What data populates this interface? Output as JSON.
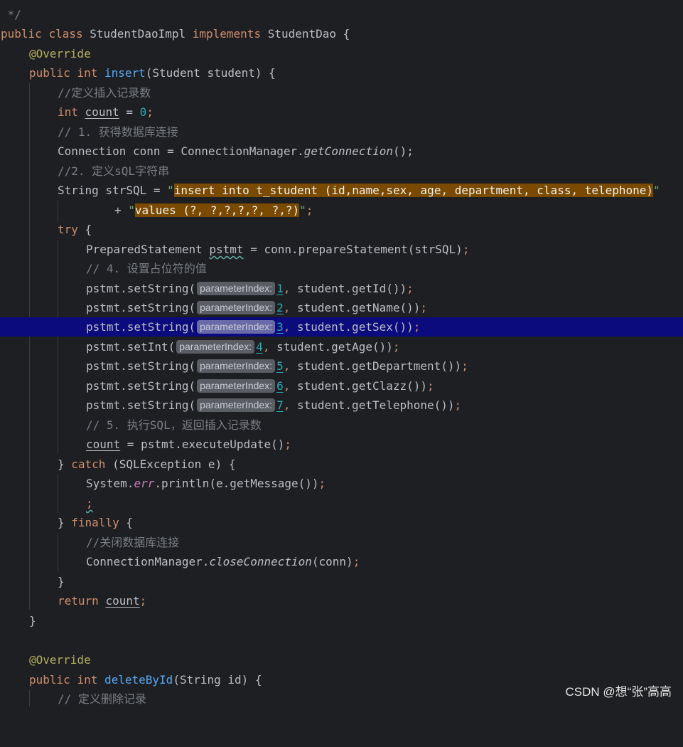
{
  "lines": {
    "l0": {
      "comment_close": " */"
    },
    "l1": {
      "kw_public": "public",
      "kw_class": "class",
      "class_name": "StudentDaoImpl",
      "kw_implements": "implements",
      "iface": "StudentDao {"
    },
    "l2": {
      "annotation": "@Override"
    },
    "l3": {
      "kw_public": "public",
      "kw_int": "int",
      "method": "insert",
      "params": "(Student student) {"
    },
    "l4": {
      "comment": "//定义插入记录数"
    },
    "l5": {
      "kw_int": "int",
      "var": "count",
      "eq": " = ",
      "num": "0",
      "semi": ";"
    },
    "l6": {
      "comment": "// 1. 获得数据库连接"
    },
    "l7": {
      "prefix": "Connection conn = ConnectionManager.",
      "call": "getConnection",
      "suffix": "();"
    },
    "l8": {
      "comment": "//2. 定义sQL字符串"
    },
    "l9": {
      "prefix": "String strSQL = ",
      "quote_open": "\"",
      "string": "insert into t_student (id,name,sex, age, department, class, telephone)",
      "quote_close": "\""
    },
    "l10": {
      "plus": "+ ",
      "quote_open": "\"",
      "string": "values (?, ?,?,?,?, ?,?)",
      "quote_close": "\"",
      "semi": ";"
    },
    "l11": {
      "kw_try": "try",
      "brace": " {"
    },
    "l12": {
      "prefix": "PreparedStatement ",
      "var": "pstmt",
      "suffix": " = conn.prepareStatement(strSQL)",
      "semi": ";"
    },
    "l13": {
      "comment": "// 4. 设置占位符的值"
    },
    "l14": {
      "prefix": "pstmt.setString(",
      "hint": "parameterIndex:",
      "num": "1",
      "comma": ",",
      "suffix": " student.getId())",
      "semi": ";"
    },
    "l15": {
      "prefix": "pstmt.setString(",
      "hint": "parameterIndex:",
      "num": "2",
      "comma": ",",
      "suffix": " student.getName())",
      "semi": ";"
    },
    "l16": {
      "prefix": "pstmt.setString(",
      "hint": "parameterIndex:",
      "num": "3",
      "comma": ",",
      "suffix": " student.getSex())",
      "semi": ";"
    },
    "l17": {
      "prefix": "pstmt.setInt(",
      "hint": "parameterIndex:",
      "num": "4",
      "comma": ",",
      "suffix": " student.getAge())",
      "semi": ";"
    },
    "l18": {
      "prefix": "pstmt.setString(",
      "hint": "parameterIndex:",
      "num": "5",
      "comma": ",",
      "suffix": " student.getDepartment())",
      "semi": ";"
    },
    "l19": {
      "prefix": "pstmt.setString(",
      "hint": "parameterIndex:",
      "num": "6",
      "comma": ",",
      "suffix": " student.getClazz())",
      "semi": ";"
    },
    "l20": {
      "prefix": "pstmt.setString(",
      "hint": "parameterIndex:",
      "num": "7",
      "comma": ",",
      "suffix": " student.getTelephone())",
      "semi": ";"
    },
    "l21": {
      "comment": "// 5. 执行SQL，返回插入记录数"
    },
    "l22": {
      "var": "count",
      "suffix": " = pstmt.executeUpdate()",
      "semi": ";"
    },
    "l23": {
      "brace": "} ",
      "kw_catch": "catch",
      "suffix": " (SQLException e) {"
    },
    "l24": {
      "prefix": "System.",
      "field": "err",
      "suffix": ".println(e.getMessage())",
      "semi": ";"
    },
    "l25": {
      "semi": ";"
    },
    "l26": {
      "brace": "} ",
      "kw_finally": "finally",
      "suffix": " {"
    },
    "l27": {
      "comment": "//关闭数据库连接"
    },
    "l28": {
      "prefix": "ConnectionManager.",
      "call": "closeConnection",
      "suffix": "(conn)",
      "semi": ";"
    },
    "l29": {
      "brace": "}"
    },
    "l30": {
      "kw_return": "return",
      "var": "count",
      "semi": ";"
    },
    "l31": {
      "brace": "}"
    },
    "l32": {
      "annotation": "@Override"
    },
    "l33": {
      "kw_public": "public",
      "kw_int": "int",
      "method": "deleteById",
      "params": "(String id) {"
    },
    "l34": {
      "comment": "// 定义删除记录"
    }
  },
  "watermark": "CSDN @想“张”高高",
  "colors": {
    "keyword": "#cf8e6d",
    "method": "#56a8f5",
    "number": "#2aacb8",
    "string": "#6aab73",
    "comment": "#7a7e85",
    "annotation": "#b3ae60",
    "current_line": "#0b0b7d",
    "string_highlight": "#7a4a00"
  }
}
